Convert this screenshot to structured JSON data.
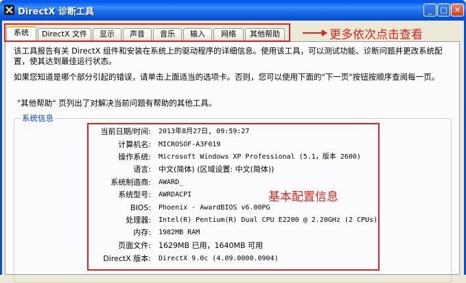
{
  "window": {
    "title": "DirectX 诊断工具",
    "minimize_glyph": "_",
    "maximize_glyph": "□",
    "close_glyph": "✕",
    "icon": "directx-x-icon"
  },
  "tabs": [
    {
      "label": "系统"
    },
    {
      "label": "DirectX 文件"
    },
    {
      "label": "显示"
    },
    {
      "label": "声音"
    },
    {
      "label": "音乐"
    },
    {
      "label": "输入"
    },
    {
      "label": "网络"
    },
    {
      "label": "其他帮助"
    }
  ],
  "annotations": {
    "more_tabs": "更多依次点击查看",
    "basic_config": "基本配置信息",
    "color": "#e0221a"
  },
  "intro": {
    "line1": "该工具报告有关 DirectX 组件和安装在系统上的驱动程序的详细信息。使用该工具，可以测试功能、诊断问题并更改系统配",
    "line2": "置，使其达到最佳运行状态。",
    "line3": "如果您知道是哪个部分引起的错误，请单击上面适当的选项卡。否则，您可以使用下面的\"下一页\"按钮按顺序查阅每一页。",
    "line4": "\"其他帮助\" 页列出了对解决当前问题有帮助的其他工具。"
  },
  "system_info": {
    "legend": "系统信息",
    "rows": [
      {
        "label": "当前日期/时间:",
        "value": "2013年8月27日, 09:59:27"
      },
      {
        "label": "计算机名:",
        "value": "MICROSOF-A3F019"
      },
      {
        "label": "操作系统:",
        "value": "Microsoft Windows XP Professional (5.1，版本 2600)"
      },
      {
        "label": "语言:",
        "value": "中文(简体) (区域设置: 中文(简体))"
      },
      {
        "label": "系统制造商:",
        "value": "AWARD_"
      },
      {
        "label": "系统型号:",
        "value": "AWRDACPI"
      },
      {
        "label": "BIOS:",
        "value": "Phoenix - AwardBIOS v6.00PG"
      },
      {
        "label": "处理器:",
        "value": "Intel(R) Pentium(R) Dual  CPU  E2200  @ 2.20GHz (2 CPUs)"
      },
      {
        "label": "内存:",
        "value": "1982MB RAM"
      },
      {
        "label": "页面文件:",
        "value": "1629MB 已用，1640MB 可用"
      },
      {
        "label": "DirectX 版本:",
        "value": "DirectX 9.0c (4.09.0000.0904)"
      }
    ]
  }
}
